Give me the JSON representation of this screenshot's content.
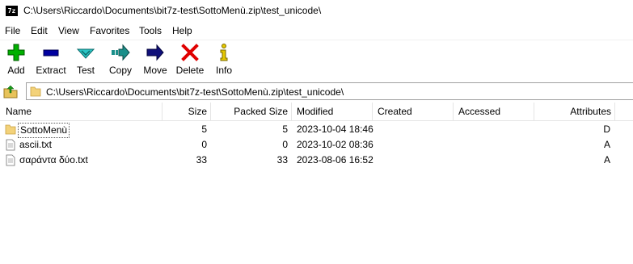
{
  "window": {
    "title": "C:\\Users\\Riccardo\\Documents\\bit7z-test\\SottoMenù.zip\\test_unicode\\",
    "app_icon": "7z"
  },
  "menu": [
    "File",
    "Edit",
    "View",
    "Favorites",
    "Tools",
    "Help"
  ],
  "toolbar": [
    {
      "label": "Add",
      "icon": "plus-icon",
      "color": "#00b000"
    },
    {
      "label": "Extract",
      "icon": "minus-icon",
      "color": "#0000a0"
    },
    {
      "label": "Test",
      "icon": "check-icon",
      "color": "#2ac5c5"
    },
    {
      "label": "Copy",
      "icon": "copy-arrow-icon",
      "color": "#1a8f8a"
    },
    {
      "label": "Move",
      "icon": "move-arrow-icon",
      "color": "#10107a"
    },
    {
      "label": "Delete",
      "icon": "delete-x-icon",
      "color": "#e00000"
    },
    {
      "label": "Info",
      "icon": "info-icon",
      "color": "#e6c800"
    }
  ],
  "address": {
    "path": "C:\\Users\\Riccardo\\Documents\\bit7z-test\\SottoMenù.zip\\test_unicode\\"
  },
  "columns": [
    "Name",
    "Size",
    "Packed Size",
    "Modified",
    "Created",
    "Accessed",
    "Attributes"
  ],
  "rows": [
    {
      "type": "folder",
      "name": "SottoMenù",
      "size": "5",
      "packed": "5",
      "modified": "2023-10-04 18:46",
      "created": "",
      "accessed": "",
      "attributes": "D"
    },
    {
      "type": "file",
      "name": "ascii.txt",
      "size": "0",
      "packed": "0",
      "modified": "2023-10-02 08:36",
      "created": "",
      "accessed": "",
      "attributes": "A"
    },
    {
      "type": "file",
      "name": "σαράντα δύο.txt",
      "size": "33",
      "packed": "33",
      "modified": "2023-08-06 16:52",
      "created": "",
      "accessed": "",
      "attributes": "A"
    }
  ]
}
